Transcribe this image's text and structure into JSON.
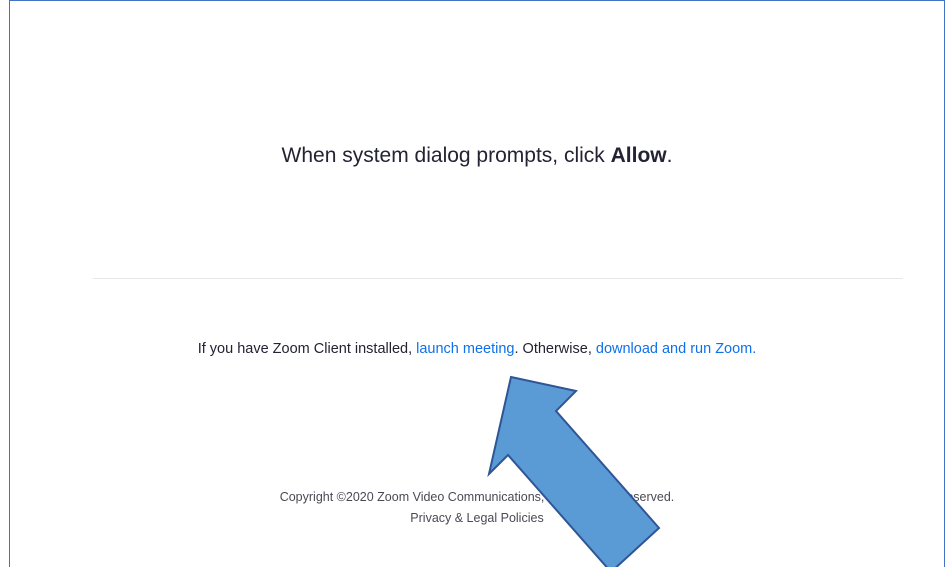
{
  "prompt": {
    "text_before": "When system dialog prompts, click ",
    "bold": "Allow",
    "text_after": "."
  },
  "launch": {
    "prefix": "If you have Zoom Client installed, ",
    "launch_link": "launch meeting",
    "middle": ". Otherwise, ",
    "download_link": "download and run Zoom."
  },
  "footer": {
    "copyright": "Copyright ©2020 Zoom Video Communications, Inc. All rights reserved.",
    "policy_link": "Privacy & Legal Policies"
  },
  "colors": {
    "link": "#0e71eb",
    "arrow_fill": "#5b9bd5",
    "arrow_stroke": "#2f5597",
    "frame_border": "#4472c4"
  },
  "icons": {
    "arrow": "up-left-arrow-icon"
  }
}
